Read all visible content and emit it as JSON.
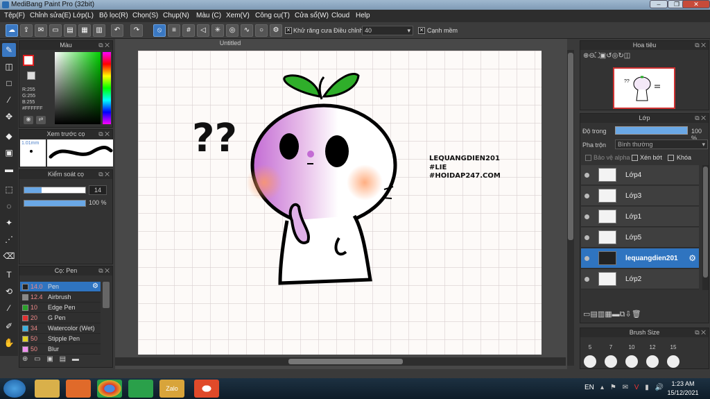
{
  "app": {
    "title": "MediBang Paint Pro (32bit)"
  },
  "menu": [
    "Tệp(F)",
    "Chỉnh sửa(E)",
    "Lớp(L)",
    "Bộ lọc(R)",
    "Chọn(S)",
    "Chụp(N)",
    "Màu (C)",
    "Xem(V)",
    "Công cụ(T)",
    "Cửa sổ(W)",
    "Cloud",
    "Help"
  ],
  "options": {
    "antialias_label": "Khử răng cưa",
    "adjust_label": "Điều chỉnh",
    "adjust_value": "40",
    "edge_label": "Cạnh mềm"
  },
  "color_panel": {
    "title": "Màu",
    "r": "R:255",
    "g": "G:255",
    "b": "B:255",
    "hex": "#FFFFFF",
    "primary_color": "#e02020",
    "secondary_color": "#ffffff"
  },
  "preview_panel": {
    "title": "Xem trước cọ",
    "size_label": "1.01mm"
  },
  "brush_control": {
    "title": "Kiểm soát cọ",
    "size_value": "14",
    "opacity_value": "100 %",
    "size_fraction": 0.28,
    "opacity_fraction": 1.0
  },
  "brush_panel": {
    "title": "Cọ: Pen",
    "brushes": [
      {
        "size": "14.0",
        "name": "Pen",
        "color": "#222222",
        "selected": true
      },
      {
        "size": "12.4",
        "name": "Airbrush",
        "color": "#888888"
      },
      {
        "size": "10",
        "name": "Edge Pen",
        "color": "#2aa02a"
      },
      {
        "size": "20",
        "name": "G Pen",
        "color": "#e03030"
      },
      {
        "size": "34",
        "name": "Watercolor (Wet)",
        "color": "#3ab0e0"
      },
      {
        "size": "50",
        "name": "Stipple Pen",
        "color": "#e0d020"
      },
      {
        "size": "50",
        "name": "Blur",
        "color": "#f090f0"
      }
    ]
  },
  "canvas": {
    "title": "Untitled",
    "watermark": [
      "LEQUANGDIEN201",
      "#LIE",
      "#HOIDAP247.COM"
    ],
    "question_marks": "??"
  },
  "navigator": {
    "title": "Hoa tiêu"
  },
  "layer_panel": {
    "title": "Lớp",
    "opacity_label": "Độ trong",
    "opacity_value": "100 %",
    "blend_label": "Pha trộn",
    "blend_value": "Bình thường",
    "protect_alpha": "Bảo vệ alpha",
    "clipping": "Xén bớt",
    "lock": "Khóa",
    "layers": [
      {
        "name": "Lớp4",
        "selected": false
      },
      {
        "name": "Lớp3",
        "selected": false
      },
      {
        "name": "Lớp1",
        "selected": false
      },
      {
        "name": "Lớp5",
        "selected": false
      },
      {
        "name": "lequangdien201",
        "selected": true
      },
      {
        "name": "Lớp2",
        "selected": false
      }
    ]
  },
  "brush_size_panel": {
    "title": "Brush Size",
    "sizes": [
      "5",
      "7",
      "10",
      "12",
      "15"
    ]
  },
  "taskbar": {
    "lang": "EN",
    "time": "1:23 AM",
    "date": "15/12/2021"
  }
}
